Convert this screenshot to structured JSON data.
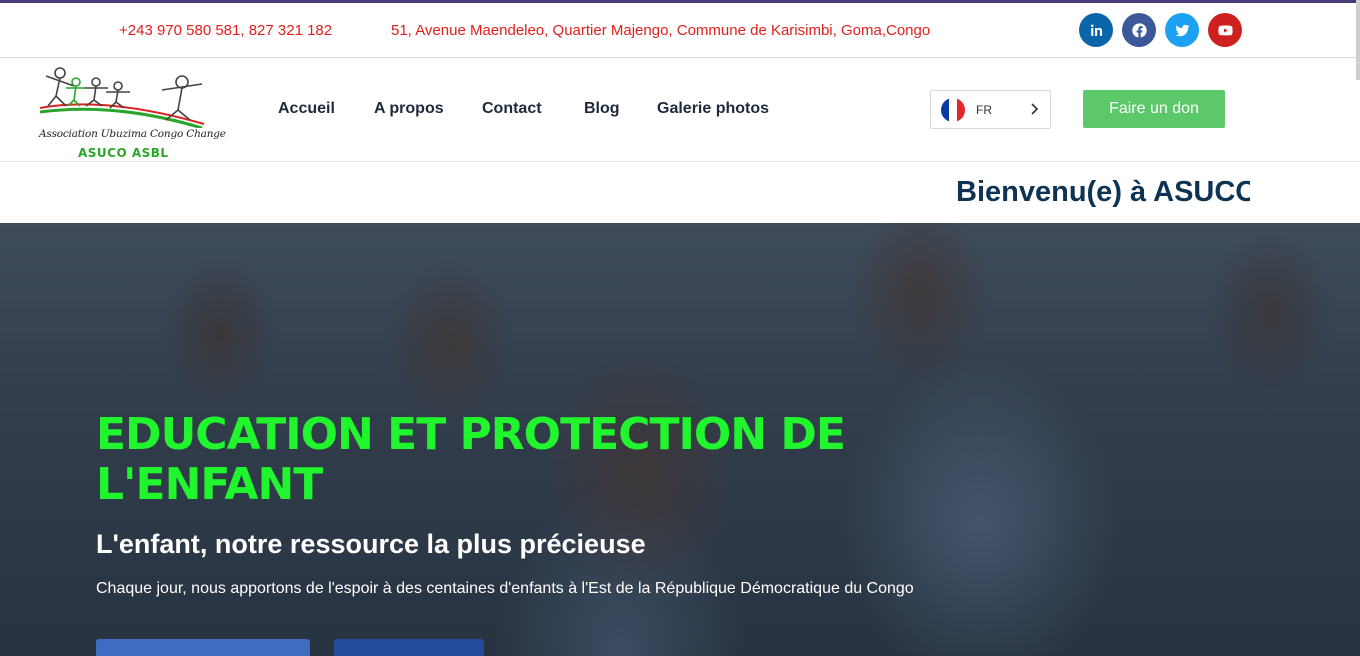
{
  "topbar": {
    "phone": "+243 970 580 581, 827 321 182",
    "address": "51, Avenue Maendeleo, Quartier Majengo, Commune de Karisimbi, Goma,Congo",
    "social": [
      {
        "name": "linkedin-icon",
        "color": "#0a66a8"
      },
      {
        "name": "facebook-icon",
        "color": "#3b5998"
      },
      {
        "name": "twitter-icon",
        "color": "#1da1f2"
      },
      {
        "name": "youtube-icon",
        "color": "#cd201f"
      }
    ]
  },
  "logo": {
    "line1": "Association Ubuzima Congo Change",
    "line2": "ASUCO ASBL"
  },
  "nav": {
    "items": [
      "Accueil",
      "A propos",
      "Contact",
      "Blog",
      "Galerie photos"
    ]
  },
  "language": {
    "code": "FR",
    "flag_colors": [
      "#0a3aa0",
      "#ffffff",
      "#e3262c"
    ]
  },
  "donate_label": "Faire un don",
  "marquee": {
    "text": "Bienvenu(e) à ASUCO"
  },
  "hero": {
    "title": "EDUCATION ET PROTECTION DE L'ENFANT",
    "subtitle": "L'enfant, notre ressource la plus précieuse",
    "description": "Chaque jour, nous apportons de l'espoir à des centaines d'enfants à l'Est de la République Démocratique du Congo",
    "title_color": "#21f52e"
  },
  "colors": {
    "accent_red": "#e0201c",
    "donate_green": "#5dc86a",
    "nav_text": "#1e2a3a",
    "marquee_text": "#0f3352",
    "topbar_border": "#4b3a7a"
  }
}
